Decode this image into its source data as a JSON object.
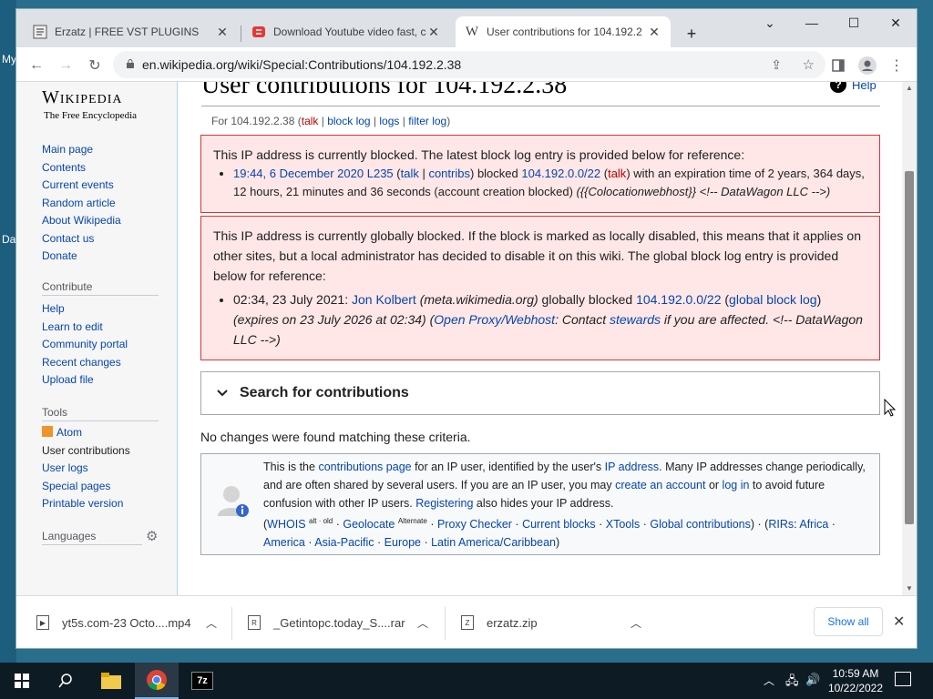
{
  "desktop": {
    "labels": [
      "My",
      "Da"
    ]
  },
  "tabs": [
    {
      "title": "Erzatz | FREE VST PLUGINS",
      "active": false
    },
    {
      "title": "Download Youtube video fast, co",
      "active": false
    },
    {
      "title": "User contributions for 104.192.2",
      "active": true
    }
  ],
  "new_tab": "+",
  "window_controls": {
    "minimize": "—",
    "maximize": "☐",
    "close": "✕",
    "dropdown": "⌄"
  },
  "address_bar": {
    "url": "en.wikipedia.org/wiki/Special:Contributions/104.192.2.38"
  },
  "sidebar": {
    "logo_title": "Wikipedia",
    "logo_tagline": "The Free Encyclopedia",
    "main_links": [
      "Main page",
      "Contents",
      "Current events",
      "Random article",
      "About Wikipedia",
      "Contact us",
      "Donate"
    ],
    "contribute_heading": "Contribute",
    "contribute_links": [
      "Help",
      "Learn to edit",
      "Community portal",
      "Recent changes",
      "Upload file"
    ],
    "tools_heading": "Tools",
    "tools_links": [
      "Atom",
      "User contributions",
      "User logs",
      "Special pages",
      "Printable version"
    ],
    "languages_heading": "Languages"
  },
  "page": {
    "title": "User contributions for 104.192.2.38",
    "help": "Help",
    "sub_for": "For 104.192.2.38 (",
    "sub_talk": "talk",
    "sub_sep1": " | ",
    "sub_blocklog": "block log",
    "sub_sep2": " | ",
    "sub_logs": "logs",
    "sub_sep3": " | ",
    "sub_filterlog": "filter log",
    "sub_end": ")",
    "block1": {
      "intro": "This IP address is currently blocked. The latest block log entry is provided below for reference:",
      "date": "19:44, 6 December 2020",
      "user": "L235",
      "talk": "talk",
      "contribs": "contribs",
      "blocked_word": " blocked ",
      "range": "104.192.0.0/22",
      "range_talk": "talk",
      "rest": " with an expiration time of 2 years, 364 days, 12 hours, 21 minutes and 36 seconds (account creation blocked) ",
      "reason": "({{Colocationwebhost}} <!-- DataWagon LLC -->)"
    },
    "block2": {
      "intro": "This IP address is currently globally blocked. If the block is marked as locally disabled, this means that it applies on other sites, but a local administrator has decided to disable it on this wiki. The global block log entry is provided below for reference:",
      "date": "02:34, 23 July 2021: ",
      "user": "Jon Kolbert",
      "site": "(meta.wikimedia.org)",
      "globally": " globally blocked ",
      "range": "104.192.0.0/22",
      "gbl": "global block log",
      "expires": "(expires on 23 July 2026 at 02:34)",
      "proxy": "Open Proxy/Webhost",
      "contact": ": Contact ",
      "stewards": "stewards",
      "tail": " if you are affected. <!-- DataWagon LLC -->)"
    },
    "search_label": "Search for contributions",
    "no_changes": "No changes were found matching these criteria.",
    "info": {
      "t1": "This is the ",
      "contrib_page": "contributions page",
      "t2": " for an IP user, identified by the user's ",
      "ip_address": "IP address",
      "t3": ". Many IP addresses change periodically, and are often shared by several users. If you are an IP user, you may ",
      "create_account": "create an account",
      "or": " or ",
      "log_in": "log in",
      "t4": " to avoid future confusion with other IP users. ",
      "registering": "Registering",
      "t5": " also hides your IP address.",
      "whois": "WHOIS",
      "whois_sup": "alt · old",
      "geolocate": "Geolocate",
      "geo_sup": "Alternate",
      "proxy_checker": "Proxy Checker",
      "current_blocks": "Current blocks",
      "xtools": "XTools",
      "global_contribs": "Global contributions",
      "rirs": "RIRs",
      "africa": "Africa",
      "america": "America",
      "asia": "Asia-Pacific",
      "europe": "Europe",
      "latam": "Latin America/Caribbean"
    }
  },
  "downloads": {
    "items": [
      "yt5s.com-23 Octo....mp4",
      "_Getintopc.today_S....rar",
      "erzatz.zip"
    ],
    "show_all": "Show all"
  },
  "taskbar": {
    "time": "10:59 AM",
    "date": "10/22/2022"
  }
}
